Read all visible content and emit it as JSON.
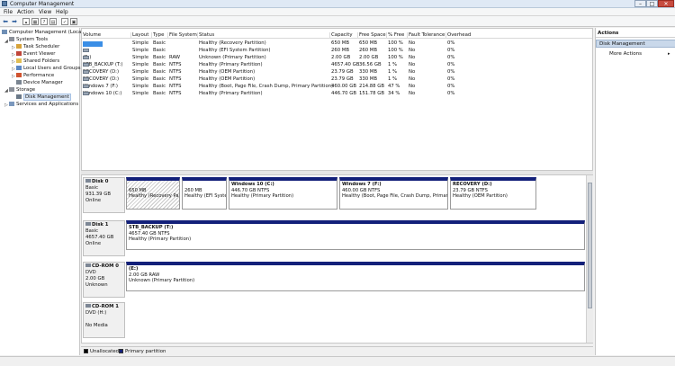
{
  "window": {
    "title": "Computer Management"
  },
  "menu": [
    "File",
    "Action",
    "View",
    "Help"
  ],
  "tree": [
    {
      "label": "Computer Management (Local",
      "indent": 0,
      "arrow": ""
    },
    {
      "label": "System Tools",
      "indent": 1,
      "arrow": "◢"
    },
    {
      "label": "Task Scheduler",
      "indent": 2,
      "arrow": "▷"
    },
    {
      "label": "Event Viewer",
      "indent": 2,
      "arrow": "▷"
    },
    {
      "label": "Shared Folders",
      "indent": 2,
      "arrow": "▷"
    },
    {
      "label": "Local Users and Groups",
      "indent": 2,
      "arrow": "▷"
    },
    {
      "label": "Performance",
      "indent": 2,
      "arrow": "▷"
    },
    {
      "label": "Device Manager",
      "indent": 2,
      "arrow": ""
    },
    {
      "label": "Storage",
      "indent": 1,
      "arrow": "◢"
    },
    {
      "label": "Disk Management",
      "indent": 2,
      "arrow": "",
      "selected": true
    },
    {
      "label": "Services and Applications",
      "indent": 1,
      "arrow": "▷"
    }
  ],
  "columns": [
    "Volume",
    "Layout",
    "Type",
    "File System",
    "Status",
    "Capacity",
    "Free Space",
    "% Free",
    "Fault Tolerance",
    "Overhead"
  ],
  "volumes": [
    {
      "volume": "",
      "redacted": true,
      "layout": "Simple",
      "type": "Basic",
      "fs": "",
      "status": "Healthy (Recovery Partition)",
      "capacity": "650 MB",
      "free": "650 MB",
      "pct": "100 %",
      "fault": "No",
      "overhead": "0%"
    },
    {
      "volume": "",
      "redacted": false,
      "layout": "Simple",
      "type": "Basic",
      "fs": "",
      "status": "Healthy (EFI System Partition)",
      "capacity": "260 MB",
      "free": "260 MB",
      "pct": "100 %",
      "fault": "No",
      "overhead": "0%"
    },
    {
      "volume": "(E:)",
      "redacted": false,
      "layout": "Simple",
      "type": "Basic",
      "fs": "RAW",
      "status": "Unknown (Primary Partition)",
      "capacity": "2.00 GB",
      "free": "2.00 GB",
      "pct": "100 %",
      "fault": "No",
      "overhead": "0%"
    },
    {
      "volume": "STB_BACKUP (T:)",
      "redacted": false,
      "layout": "Simple",
      "type": "Basic",
      "fs": "NTFS",
      "status": "Healthy (Primary Partition)",
      "capacity": "4657.40 GB",
      "free": "36.56 GB",
      "pct": "1 %",
      "fault": "No",
      "overhead": "0%"
    },
    {
      "volume": "RECOVERY (D:)",
      "redacted": false,
      "layout": "Simple",
      "type": "Basic",
      "fs": "NTFS",
      "status": "Healthy (OEM Partition)",
      "capacity": "23.79 GB",
      "free": "330 MB",
      "pct": "1 %",
      "fault": "No",
      "overhead": "0%"
    },
    {
      "volume": "RECOVERY (D:)",
      "redacted": false,
      "layout": "Simple",
      "type": "Basic",
      "fs": "NTFS",
      "status": "Healthy (OEM Partition)",
      "capacity": "23.79 GB",
      "free": "330 MB",
      "pct": "1 %",
      "fault": "No",
      "overhead": "0%"
    },
    {
      "volume": "Windows 7 (F:)",
      "redacted": false,
      "layout": "Simple",
      "type": "Basic",
      "fs": "NTFS",
      "status": "Healthy (Boot, Page File, Crash Dump, Primary Partition)",
      "capacity": "460.00 GB",
      "free": "214.88 GB",
      "pct": "47 %",
      "fault": "No",
      "overhead": "0%"
    },
    {
      "volume": "Windows 10 (C:)",
      "redacted": false,
      "layout": "Simple",
      "type": "Basic",
      "fs": "NTFS",
      "status": "Healthy (Primary Partition)",
      "capacity": "446.70 GB",
      "free": "151.78 GB",
      "pct": "34 %",
      "fault": "No",
      "overhead": "0%"
    }
  ],
  "disks": [
    {
      "name": "Disk 0",
      "lines": [
        "Basic",
        "931.39 GB",
        "Online"
      ],
      "partitions": [
        {
          "name": "",
          "lines": [
            "650 MB",
            "Healthy (Recovery Pa"
          ],
          "hatched": true
        },
        {
          "name": "",
          "lines": [
            "260 MB",
            "Healthy (EFI Syster"
          ],
          "hatched": false
        },
        {
          "name": "Windows 10  (C:)",
          "lines": [
            "446.70 GB NTFS",
            "Healthy (Primary Partition)"
          ],
          "hatched": false
        },
        {
          "name": "Windows 7  (F:)",
          "lines": [
            "460.00 GB NTFS",
            "Healthy (Boot, Page File, Crash Dump, Primary"
          ],
          "hatched": false
        },
        {
          "name": "RECOVERY  (D:)",
          "lines": [
            "23.79 GB NTFS",
            "Healthy (OEM Partition)"
          ],
          "hatched": false
        }
      ]
    },
    {
      "name": "Disk 1",
      "lines": [
        "Basic",
        "4657.40 GB",
        "Online"
      ],
      "partitions": [
        {
          "name": "STB_BACKUP  (T:)",
          "lines": [
            "4657.40 GB NTFS",
            "Healthy (Primary Partition)"
          ],
          "hatched": false
        }
      ]
    },
    {
      "name": "CD-ROM 0",
      "lines": [
        "DVD",
        "2.00 GB",
        "Unknown"
      ],
      "partitions": [
        {
          "name": "(E:)",
          "lines": [
            "2.00 GB RAW",
            "Unknown (Primary Partition)"
          ],
          "hatched": false
        }
      ]
    },
    {
      "name": "CD-ROM 1",
      "lines": [
        "DVD (H:)",
        "",
        "No Media"
      ],
      "partitions": []
    }
  ],
  "legend": [
    {
      "label": "Unallocated",
      "color": "#000000"
    },
    {
      "label": "Primary partition",
      "color": "#13207a"
    }
  ],
  "actions": {
    "header": "Actions",
    "section": "Disk Management",
    "more": "More Actions"
  }
}
